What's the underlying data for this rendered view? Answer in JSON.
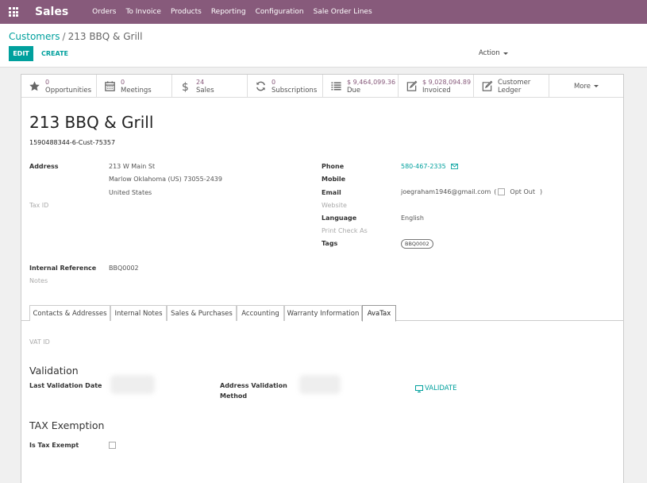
{
  "app": {
    "name": "Sales"
  },
  "menu": [
    "Orders",
    "To Invoice",
    "Products",
    "Reporting",
    "Configuration",
    "Sale Order Lines"
  ],
  "breadcrumb": {
    "parent": "Customers",
    "separator": "/",
    "current": "213 BBQ & Grill"
  },
  "toolbar": {
    "edit": "EDIT",
    "create": "CREATE",
    "action": "Action"
  },
  "stats": [
    {
      "value": "0",
      "label": "Opportunities",
      "icon": "star-icon"
    },
    {
      "value": "0",
      "label": "Meetings",
      "icon": "calendar-icon"
    },
    {
      "value": "24",
      "label": "Sales",
      "icon": "dollar-icon"
    },
    {
      "value": "0",
      "label": "Subscriptions",
      "icon": "refresh-icon"
    },
    {
      "value": "$ 9,464,099.36",
      "label": "Due",
      "icon": "list-icon"
    },
    {
      "value": "$ 9,028,094.89",
      "label": "Invoiced",
      "icon": "edit-icon"
    },
    {
      "value": "Customer",
      "label": "Ledger",
      "icon": "edit-icon"
    }
  ],
  "more": "More",
  "partner": {
    "name": "213 BBQ & Grill",
    "ref_code": "1590488344-6-Cust-75357",
    "address_label": "Address",
    "address_line1": "213 W Main St",
    "address_line2": "Marlow  Oklahoma (US)  73055-2439",
    "address_line3": "United States",
    "tax_id_label": "Tax ID",
    "internal_ref_label": "Internal Reference",
    "internal_ref": "BBQ0002",
    "notes_label": "Notes",
    "phone_label": "Phone",
    "phone": "580-467-2335",
    "mobile_label": "Mobile",
    "email_label": "Email",
    "email": "joegraham1946@gmail.com",
    "opt_out_label": "Opt Out",
    "website_label": "Website",
    "language_label": "Language",
    "language": "English",
    "print_check_label": "Print Check As",
    "tags_label": "Tags",
    "tag": "BBQ0002"
  },
  "tabs": [
    "Contacts & Addresses",
    "Internal Notes",
    "Sales & Purchases",
    "Accounting",
    "Warranty Information",
    "AvaTax"
  ],
  "avatax": {
    "vat_label": "VAT ID",
    "validation_title": "Validation",
    "last_validation_label": "Last Validation Date",
    "addr_validation_label_1": "Address Validation",
    "addr_validation_label_2": "Method",
    "validate": "VALIDATE",
    "tax_exemption_title": "TAX Exemption",
    "is_tax_exempt_label": "Is Tax Exempt"
  },
  "colors": {
    "brand": "#875a7b",
    "accent": "#00a09d"
  }
}
